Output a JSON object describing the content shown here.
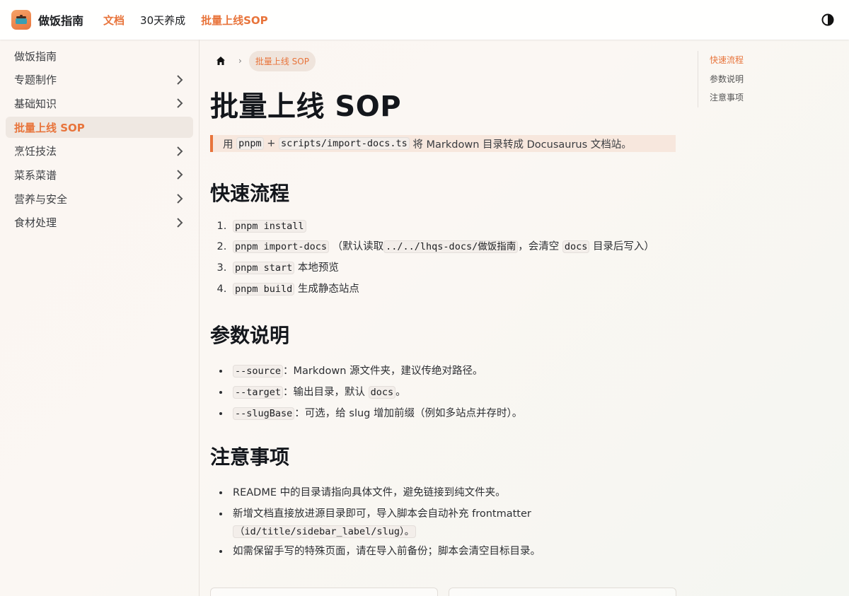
{
  "navbar": {
    "brand": "做饭指南",
    "links": [
      {
        "label": "文档",
        "active": true
      },
      {
        "label": "30天养成",
        "active": false
      },
      {
        "label": "批量上线SOP",
        "active": true
      }
    ]
  },
  "sidebar": {
    "items": [
      {
        "label": "做饭指南",
        "expandable": false,
        "active": false
      },
      {
        "label": "专题制作",
        "expandable": true,
        "active": false
      },
      {
        "label": "基础知识",
        "expandable": true,
        "active": false
      },
      {
        "label": "批量上线 SOP",
        "expandable": false,
        "active": true
      },
      {
        "label": "烹饪技法",
        "expandable": true,
        "active": false
      },
      {
        "label": "菜系菜谱",
        "expandable": true,
        "active": false
      },
      {
        "label": "营养与安全",
        "expandable": true,
        "active": false
      },
      {
        "label": "食材处理",
        "expandable": true,
        "active": false
      }
    ]
  },
  "breadcrumb": {
    "current": "批量上线 SOP"
  },
  "page": {
    "title": "批量上线 SOP",
    "callout": {
      "prefix": "用",
      "code1": "pnpm",
      "plus": "+",
      "code2": "scripts/import-docs.ts",
      "suffix": "将 Markdown 目录转成 Docusaurus 文档站。"
    },
    "sections": {
      "quick": {
        "title": "快速流程",
        "items": [
          {
            "code": "pnpm install",
            "text": ""
          },
          {
            "code": "pnpm import-docs",
            "text_a": "（默认读取",
            "code_b": "../../lhqs-docs/做饭指南",
            "text_c": "，会清空",
            "code_d": "docs",
            "text_e": "目录后写入）"
          },
          {
            "code": "pnpm start",
            "text": "本地预览"
          },
          {
            "code": "pnpm build",
            "text": "生成静态站点"
          }
        ]
      },
      "params": {
        "title": "参数说明",
        "items": [
          {
            "code": "--source",
            "text": "：Markdown 源文件夹，建议传绝对路径。"
          },
          {
            "code": "--target",
            "text": "：输出目录，默认",
            "code2": "docs",
            "text2": "。"
          },
          {
            "code": "--slugBase",
            "text": "：可选，给 slug 增加前缀（例如多站点并存时）。"
          }
        ]
      },
      "notes": {
        "title": "注意事项",
        "items": [
          {
            "text": "README 中的目录请指向具体文件，避免链接到纯文件夹。"
          },
          {
            "text": "新增文档直接放进源目录即可，导入脚本会自动补充 frontmatter",
            "code": "（id/title/sidebar_label/slug）。"
          },
          {
            "text": "如需保留手写的特殊页面，请在导入前备份；脚本会清空目标目录。"
          }
        ]
      }
    }
  },
  "toc": {
    "items": [
      {
        "label": "快速流程",
        "active": true
      },
      {
        "label": "参数说明",
        "active": false
      },
      {
        "label": "注意事项",
        "active": false
      }
    ]
  },
  "colors": {
    "accent": "#e8743b",
    "active_bg": "#efe8e2"
  }
}
